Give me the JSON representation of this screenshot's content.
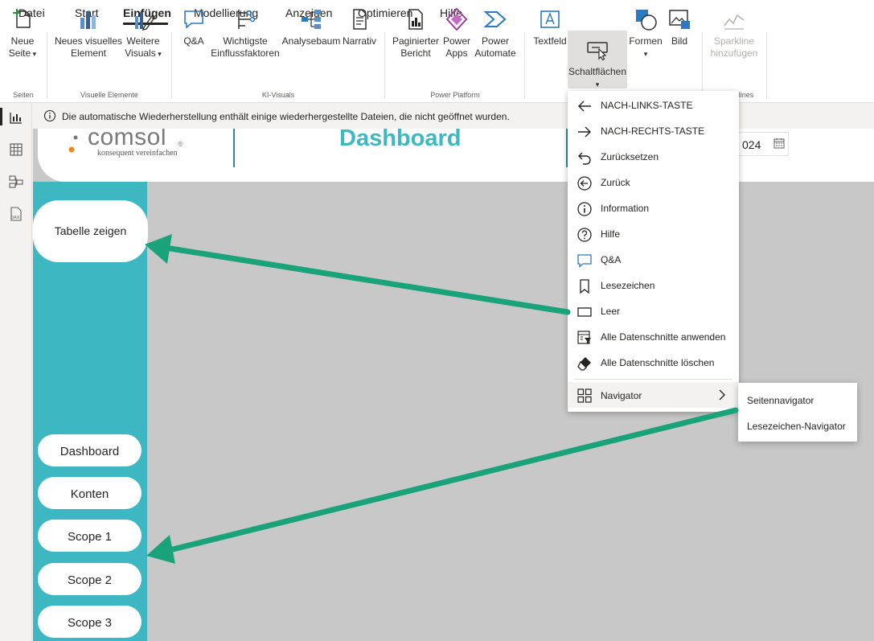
{
  "menu": {
    "items": [
      "Datei",
      "Start",
      "Einfügen",
      "Modellierung",
      "Anzeigen",
      "Optimieren",
      "Hilfe"
    ],
    "active": "Einfügen"
  },
  "ribbon": {
    "groups": {
      "seiten": "Seiten",
      "visuelle_elemente": "Visuelle Elemente",
      "ki_visuals": "KI-Visuals",
      "power_platform": "Power Platform",
      "lines_partial": "lines"
    },
    "buttons": {
      "neue_seite": [
        "Neue",
        "Seite"
      ],
      "neues_visuelles_element": [
        "Neues visuelles",
        "Element"
      ],
      "weitere_visuals": [
        "Weitere",
        "Visuals"
      ],
      "qa": "Q&A",
      "wichtigste": [
        "Wichtigste",
        "Einflussfaktoren"
      ],
      "analysebaum": "Analysebaum",
      "narrativ": "Narrativ",
      "paginierter": [
        "Paginierter",
        "Bericht"
      ],
      "power_apps": [
        "Power",
        "Apps"
      ],
      "power_automate": [
        "Power",
        "Automate"
      ],
      "textfeld": "Textfeld",
      "schaltflaechen": "Schaltflächen",
      "formen": "Formen",
      "bild": "Bild",
      "sparkline": [
        "Sparkline",
        "hinzufügen"
      ]
    }
  },
  "infobar": {
    "message": "Die automatische Wiederherstellung enthält einige wiederhergestellte Dateien, die nicht geöffnet wurden."
  },
  "report": {
    "logo_text": "comsol",
    "logo_mark": "®",
    "logo_tagline": "konsequent vereinfachen",
    "title": "Dashboard",
    "date_partial": "024",
    "table_button": "Tabelle zeigen",
    "nav_buttons": [
      "Dashboard",
      "Konten",
      "Scope 1",
      "Scope 2",
      "Scope 3"
    ]
  },
  "dropdown": {
    "items": [
      "NACH-LINKS-TASTE",
      "NACH-RECHTS-TASTE",
      "Zurücksetzen",
      "Zurück",
      "Information",
      "Hilfe",
      "Q&A",
      "Lesezeichen",
      "Leer",
      "Alle Datenschnitte anwenden",
      "Alle Datenschnitte löschen",
      "Navigator"
    ]
  },
  "submenu": {
    "items": [
      "Seitennavigator",
      "Lesezeichen-Navigator"
    ]
  },
  "colors": {
    "teal": "#3db8c3",
    "annotation_green": "#1aa37a",
    "canvas_gray": "#c8c8c8"
  }
}
